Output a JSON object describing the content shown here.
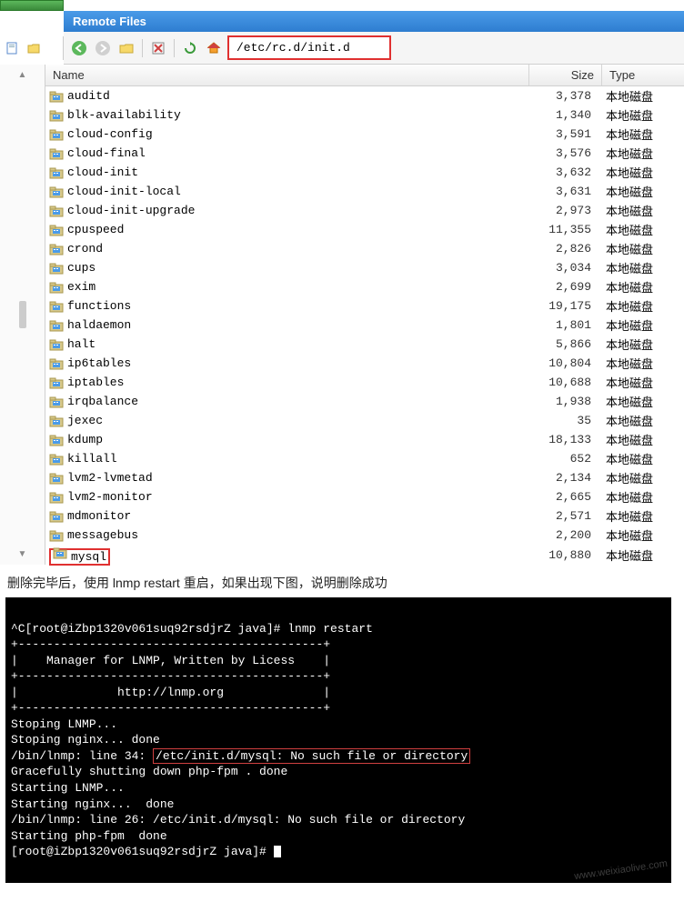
{
  "header": {
    "title": "Remote Files"
  },
  "address": {
    "path": "/etc/rc.d/init.d"
  },
  "columns": {
    "name": "Name",
    "size": "Size",
    "type": "Type"
  },
  "file_type_label": "本地磁盘",
  "files": [
    {
      "name": "auditd",
      "size": "3,378"
    },
    {
      "name": "blk-availability",
      "size": "1,340"
    },
    {
      "name": "cloud-config",
      "size": "3,591"
    },
    {
      "name": "cloud-final",
      "size": "3,576"
    },
    {
      "name": "cloud-init",
      "size": "3,632"
    },
    {
      "name": "cloud-init-local",
      "size": "3,631"
    },
    {
      "name": "cloud-init-upgrade",
      "size": "2,973"
    },
    {
      "name": "cpuspeed",
      "size": "11,355"
    },
    {
      "name": "crond",
      "size": "2,826"
    },
    {
      "name": "cups",
      "size": "3,034"
    },
    {
      "name": "exim",
      "size": "2,699"
    },
    {
      "name": "functions",
      "size": "19,175"
    },
    {
      "name": "haldaemon",
      "size": "1,801"
    },
    {
      "name": "halt",
      "size": "5,866"
    },
    {
      "name": "ip6tables",
      "size": "10,804"
    },
    {
      "name": "iptables",
      "size": "10,688"
    },
    {
      "name": "irqbalance",
      "size": "1,938"
    },
    {
      "name": "jexec",
      "size": "35"
    },
    {
      "name": "kdump",
      "size": "18,133"
    },
    {
      "name": "killall",
      "size": "652"
    },
    {
      "name": "lvm2-lvmetad",
      "size": "2,134"
    },
    {
      "name": "lvm2-monitor",
      "size": "2,665"
    },
    {
      "name": "mdmonitor",
      "size": "2,571"
    },
    {
      "name": "messagebus",
      "size": "2,200"
    },
    {
      "name": "mysql",
      "size": "10,880",
      "highlighted": true
    }
  ],
  "instruction_text": "删除完毕后，使用 lnmp restart 重启，如果出现下图，说明删除成功",
  "terminal": {
    "lines": [
      "^C[root@iZbp1320v061suq92rsdjrZ java]# lnmp restart",
      "+-------------------------------------------+",
      "|    Manager for LNMP, Written by Licess    |",
      "+-------------------------------------------+",
      "|              http://lnmp.org              |",
      "+-------------------------------------------+",
      "Stoping LNMP...",
      "Stoping nginx... done",
      "/bin/lnmp: line 34: ",
      "/etc/init.d/mysql: No such file or directory",
      "Gracefully shutting down php-fpm . done",
      "Starting LNMP...",
      "Starting nginx...  done",
      "/bin/lnmp: line 26: /etc/init.d/mysql: No such file or directory",
      "Starting php-fpm  done",
      "[root@iZbp1320v061suq92rsdjrZ java]# "
    ],
    "watermark": "www.weixiaolive.com"
  }
}
